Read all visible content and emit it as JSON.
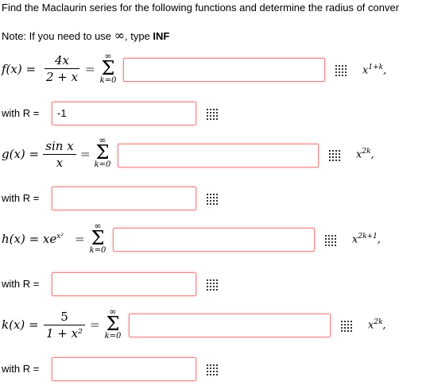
{
  "header": {
    "instruction": "Find the Maclaurin series for the following functions and determine the radius of conver",
    "note_prefix": "Note: If you need to use ",
    "note_symbol": "∞",
    "note_middle": ", type ",
    "note_keyword": "INF"
  },
  "sum": {
    "upper": "∞",
    "sigma": "Σ",
    "lower": "k=0"
  },
  "problems": [
    {
      "fn_label": "f(x) =",
      "numerator": "4x",
      "denominator": "2 + x",
      "series_value": "",
      "term_base": "x",
      "term_exp": "1+k",
      "term_punct": ",",
      "radius_label": "with R =",
      "radius_value": "-1"
    },
    {
      "fn_label": "g(x) =",
      "numerator": "sin x",
      "denominator": "x",
      "series_value": "",
      "term_base": "x",
      "term_exp": "2k",
      "term_punct": ",",
      "radius_label": "with R =",
      "radius_value": ""
    },
    {
      "fn_label": "h(x) = xe",
      "fn_exp": "x²",
      "series_value": "",
      "term_base": "x",
      "term_exp": "2k+1",
      "term_punct": ",",
      "radius_label": "with R =",
      "radius_value": ""
    },
    {
      "fn_label": "k(x) =",
      "numerator": "5",
      "denominator": "1 + x²",
      "series_value": "",
      "term_base": "x",
      "term_exp": "2k",
      "term_punct": ",",
      "radius_label": "with R =",
      "radius_value": ""
    }
  ],
  "icons": {
    "palette": "grid-palette-icon"
  },
  "colors": {
    "field_border": "#ee8888"
  }
}
